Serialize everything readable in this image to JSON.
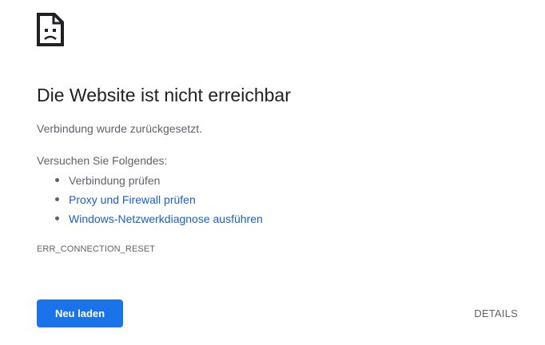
{
  "page": {
    "heading": "Die Website ist nicht erreichbar",
    "summary": "Verbindung wurde zurückgesetzt.",
    "suggestions_intro": "Versuchen Sie Folgendes:",
    "suggestions": [
      {
        "label": "Verbindung prüfen",
        "link": false
      },
      {
        "label": "Proxy und Firewall prüfen",
        "link": true
      },
      {
        "label": "Windows-Netzwerkdiagnose ausführen",
        "link": true
      }
    ],
    "error_code": "ERR_CONNECTION_RESET",
    "reload_label": "Neu laden",
    "details_label": "DETAILS",
    "icon": "sad-page-icon",
    "colors": {
      "text": "#202124",
      "secondary_text": "#5f6368",
      "link": "#1a5fc8",
      "button": "#1a73e8"
    }
  }
}
